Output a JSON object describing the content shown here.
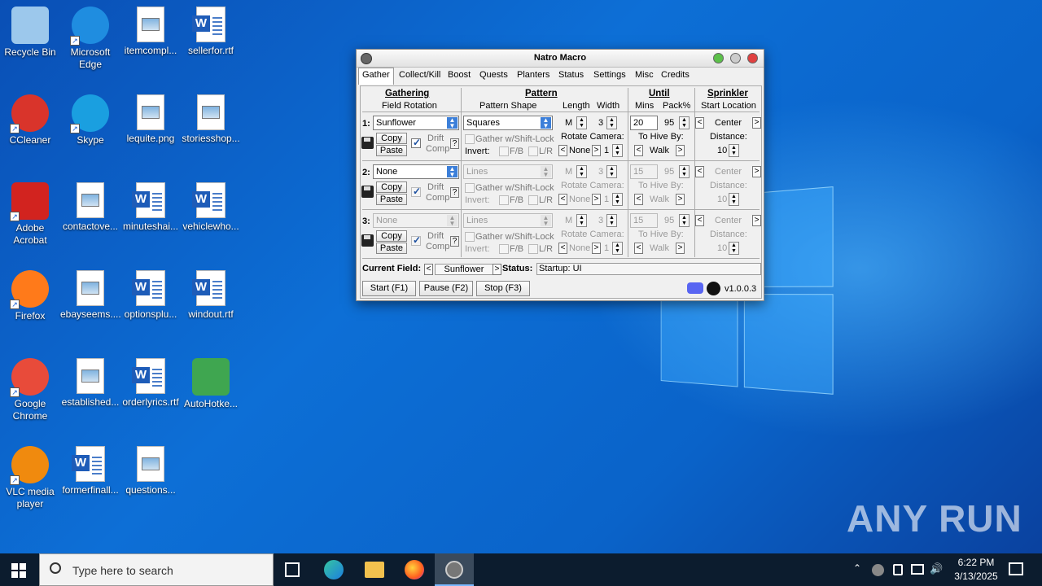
{
  "desktop": {
    "icons": [
      {
        "label": "Recycle Bin",
        "icon": "recycle-bin-icon"
      },
      {
        "label": "Microsoft Edge",
        "icon": "edge-icon"
      },
      {
        "label": "itemcompl...",
        "icon": "image-file-icon"
      },
      {
        "label": "sellerfor.rtf",
        "icon": "word-doc-icon"
      },
      {
        "label": "CCleaner",
        "icon": "ccleaner-icon"
      },
      {
        "label": "Skype",
        "icon": "skype-icon"
      },
      {
        "label": "lequite.png",
        "icon": "image-file-icon"
      },
      {
        "label": "storiesshop...",
        "icon": "image-file-icon"
      },
      {
        "label": "Adobe Acrobat",
        "icon": "acrobat-icon"
      },
      {
        "label": "contactove...",
        "icon": "image-file-icon"
      },
      {
        "label": "minuteshai...",
        "icon": "word-doc-icon"
      },
      {
        "label": "vehiclewho...",
        "icon": "word-doc-icon"
      },
      {
        "label": "Firefox",
        "icon": "firefox-icon"
      },
      {
        "label": "ebayseems....",
        "icon": "image-file-icon"
      },
      {
        "label": "optionsplu...",
        "icon": "word-doc-icon"
      },
      {
        "label": "windout.rtf",
        "icon": "word-doc-icon"
      },
      {
        "label": "Google Chrome",
        "icon": "chrome-icon"
      },
      {
        "label": "established...",
        "icon": "image-file-icon"
      },
      {
        "label": "orderlyrics.rtf",
        "icon": "word-doc-icon"
      },
      {
        "label": "AutoHotke...",
        "icon": "autohotkey-icon"
      },
      {
        "label": "VLC media player",
        "icon": "vlc-icon"
      },
      {
        "label": "formerfinall...",
        "icon": "word-doc-icon"
      },
      {
        "label": "questions...",
        "icon": "image-file-icon"
      }
    ]
  },
  "window": {
    "title": "Natro Macro",
    "tabs": [
      "Gather",
      "Collect/Kill",
      "Boost",
      "Quests",
      "Planters",
      "Status",
      "Settings",
      "Misc",
      "Credits"
    ],
    "headers": {
      "gathering": "Gathering",
      "field_rotation": "Field Rotation",
      "pattern": "Pattern",
      "pattern_shape": "Pattern Shape",
      "length": "Length",
      "width": "Width",
      "until": "Until",
      "mins": "Mins",
      "pack": "Pack%",
      "sprinkler": "Sprinkler",
      "start_location": "Start Location"
    },
    "labels": {
      "copy": "Copy",
      "paste": "Paste",
      "drift": "Drift",
      "comp": "Comp",
      "help": "?",
      "gather_shift": "Gather w/Shift-Lock",
      "invert": "Invert:",
      "fb": "F/B",
      "lr": "L/R",
      "rotate_camera": "Rotate Camera:",
      "to_hive_by": "To Hive By:",
      "distance": "Distance:",
      "none": "None",
      "walk": "Walk",
      "prev": "<",
      "next": ">"
    },
    "rows": [
      {
        "num": "1:",
        "field": "Sunflower",
        "shape": "Squares",
        "length": "M",
        "width": "3",
        "mins": "20",
        "pack": "95",
        "sprinkler": "Center",
        "rotate": "1",
        "distance": "10"
      },
      {
        "num": "2:",
        "field": "None",
        "shape": "Lines",
        "length": "M",
        "width": "3",
        "mins": "15",
        "pack": "95",
        "sprinkler": "Center",
        "rotate": "1",
        "distance": "10"
      },
      {
        "num": "3:",
        "field": "None",
        "shape": "Lines",
        "length": "M",
        "width": "3",
        "mins": "15",
        "pack": "95",
        "sprinkler": "Center",
        "rotate": "1",
        "distance": "10"
      }
    ],
    "footer": {
      "current_field_label": "Current Field:",
      "current_field": "Sunflower",
      "status_label": "Status:",
      "status": "Startup: UI",
      "start": "Start (F1)",
      "pause": "Pause (F2)",
      "stop": "Stop (F3)",
      "version": "v1.0.0.3"
    }
  },
  "taskbar": {
    "search_placeholder": "Type here to search",
    "time": "6:22 PM",
    "date": "3/13/2025"
  },
  "watermark": "ANY RUN"
}
